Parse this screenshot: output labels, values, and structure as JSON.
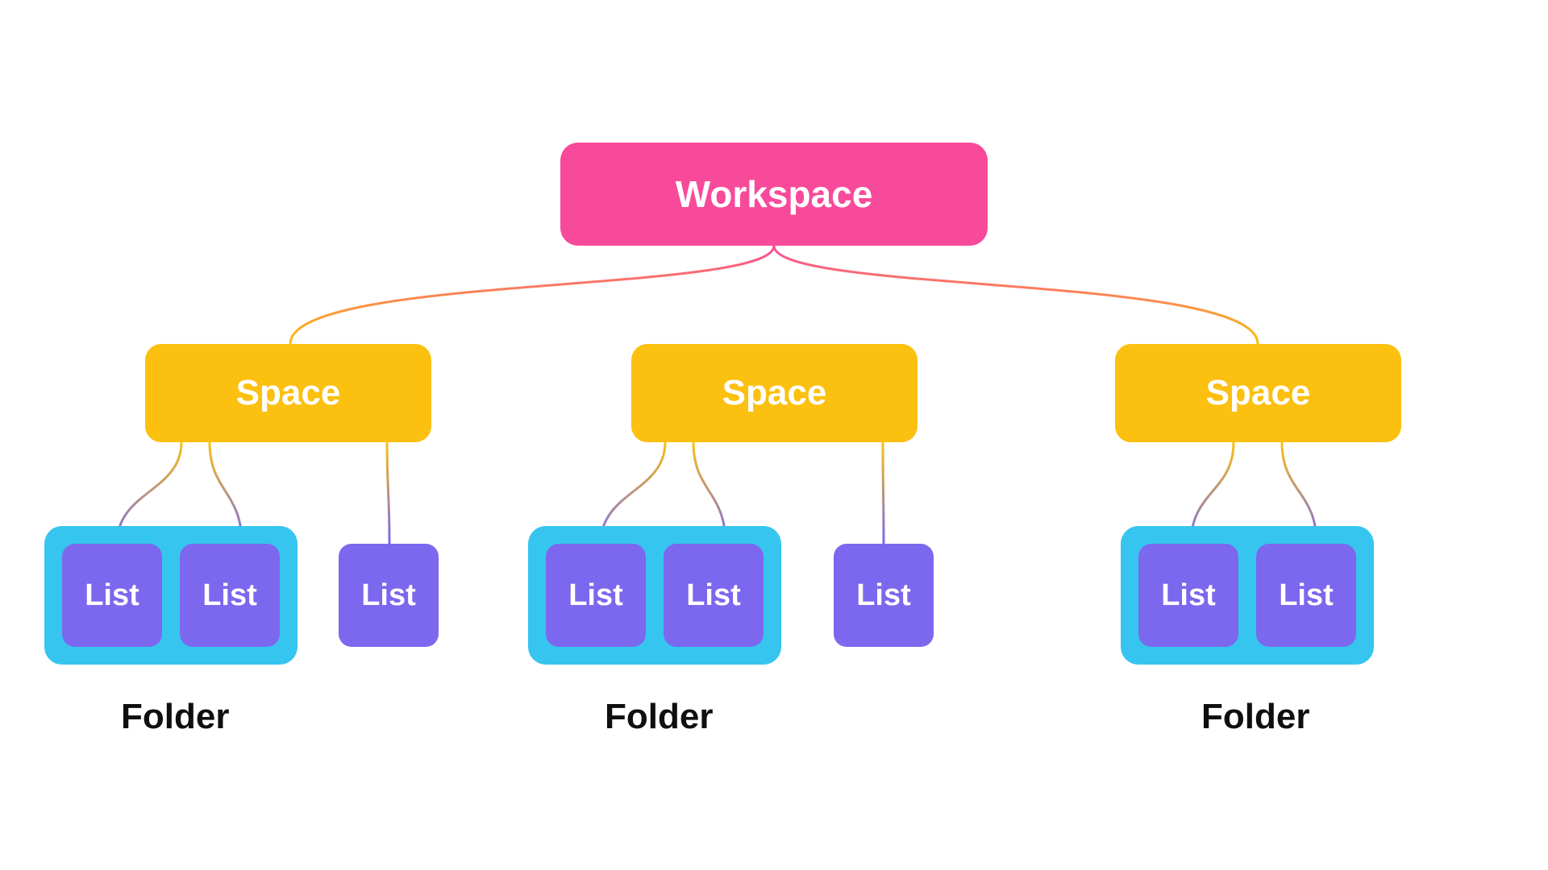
{
  "colors": {
    "workspace": "#f84a9a",
    "space": "#fbc010",
    "folder_bg": "#36c5ef",
    "list": "#7b68ee",
    "text_on_color": "#ffffff",
    "text_on_white": "#0f0f0f"
  },
  "hierarchy": {
    "workspace_label": "Workspace",
    "spaces": [
      {
        "label": "Space",
        "folders": [
          {
            "label": "Folder",
            "lists": [
              "List",
              "List"
            ]
          }
        ],
        "loose_lists": [
          "List"
        ]
      },
      {
        "label": "Space",
        "folders": [
          {
            "label": "Folder",
            "lists": [
              "List",
              "List"
            ]
          }
        ],
        "loose_lists": [
          "List"
        ]
      },
      {
        "label": "Space",
        "folders": [
          {
            "label": "Folder",
            "lists": [
              "List",
              "List"
            ]
          }
        ],
        "loose_lists": []
      }
    ]
  }
}
